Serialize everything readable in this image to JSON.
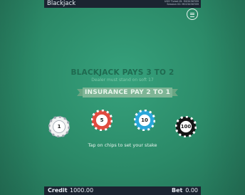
{
  "header": {
    "title": "Blackjack",
    "ugs_ticket": "UGS Ticket ID: M03456789",
    "session_id": "Session ID: M023456789"
  },
  "menu": {
    "icon": "hamburger-icon"
  },
  "table": {
    "pays_text": "BLACKJACK PAYS 3 TO 2",
    "stand_text": "Dealer must stand on soft 17",
    "insurance_text": "INSURANCE PAY 2 TO 1"
  },
  "chips": [
    {
      "value": "1",
      "color": "#f2f2f2",
      "accent": "#9aa4ad"
    },
    {
      "value": "5",
      "color": "#e04b3f",
      "accent": "#ffffff"
    },
    {
      "value": "10",
      "color": "#29a6d9",
      "accent": "#ffffff"
    },
    {
      "value": "100",
      "color": "#151515",
      "accent": "#ffffff"
    }
  ],
  "hint": "Tap on chips to set your stake",
  "footer": {
    "credit_label": "Credit",
    "credit_value": "1000.00",
    "bet_label": "Bet",
    "bet_value": "0.00"
  },
  "colors": {
    "felt": "#2e8f6d",
    "bar": "#1b2431",
    "ribbon": "#7fb596"
  }
}
